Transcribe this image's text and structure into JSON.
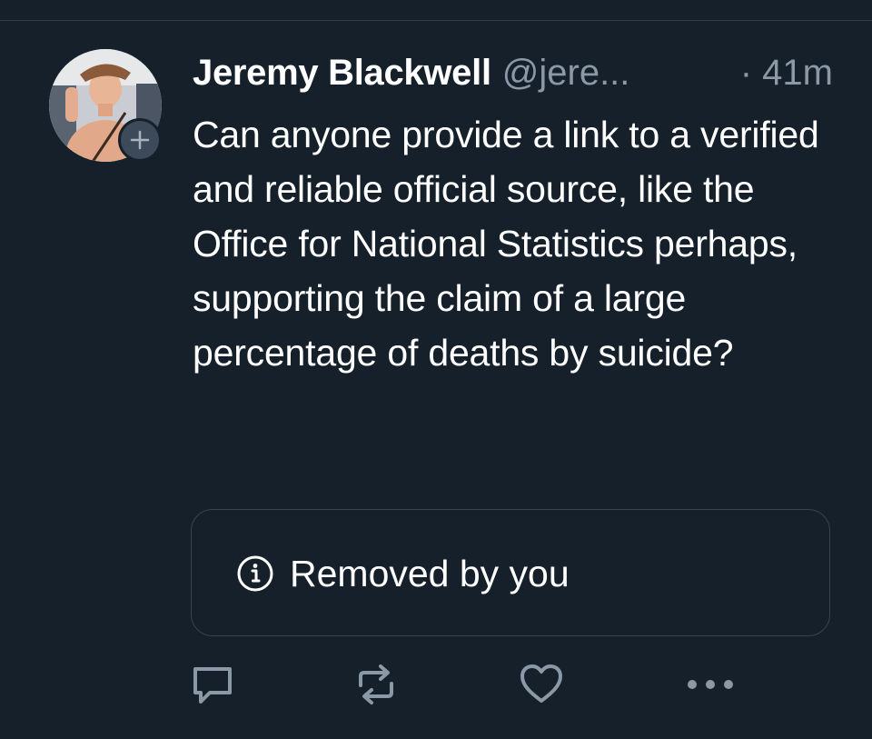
{
  "tweet": {
    "display_name": "Jeremy Blackwell",
    "handle": "@jere...",
    "time": "· 41m",
    "text": "Can anyone provide a link to a verified and reliable official source, like the Office for National Statistics perhaps, supporting the claim of a large percentage of deaths by suicide?",
    "notice": "Removed by you"
  },
  "icons": {
    "follow": "plus-icon",
    "notice": "info-icon",
    "reply": "reply-icon",
    "retweet": "retweet-icon",
    "like": "heart-icon",
    "more": "more-icon"
  },
  "colors": {
    "background": "#15202b",
    "text": "#ffffff",
    "secondary": "#8b98a5",
    "border": "#38444d",
    "icon": "#8b98a5"
  }
}
